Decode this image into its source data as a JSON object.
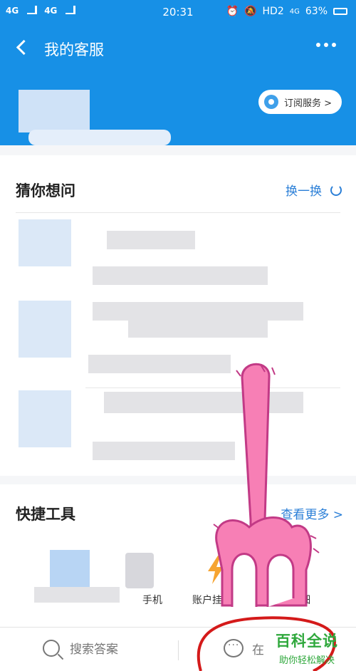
{
  "status_bar": {
    "network1": "4G",
    "network2": "4G",
    "time": "20:31",
    "hd": "HD2",
    "net_small": "4G",
    "battery": "63%"
  },
  "header": {
    "title": "我的客服"
  },
  "banner": {
    "subscribe_label": "订阅服务 >"
  },
  "guess": {
    "title": "猜你想问",
    "refresh_label": "换一换"
  },
  "tools": {
    "title": "快捷工具",
    "more_label": "查看更多 >",
    "items": [
      {
        "label": "手机"
      },
      {
        "label": "账户挂失"
      },
      {
        "label": "余额宝明细"
      }
    ]
  },
  "bottom_bar": {
    "search_label": "搜索答案",
    "chat_label": "在"
  },
  "watermark": {
    "main": "百科全说",
    "sub": "助你轻松解决"
  },
  "colors": {
    "brand_blue": "#1790e6",
    "link_blue": "#2b7fd7",
    "annotation_pink": "#f77fb5",
    "annotation_red": "#d41a1a",
    "watermark_green": "#2fa83c"
  }
}
